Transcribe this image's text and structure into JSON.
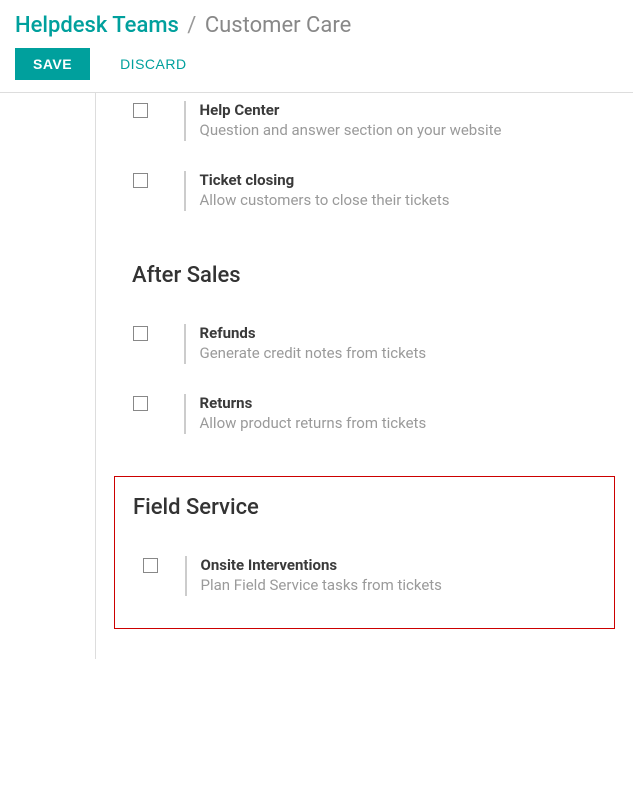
{
  "breadcrumb": {
    "parent": "Helpdesk Teams",
    "separator": "/",
    "current": "Customer Care"
  },
  "actions": {
    "save": "SAVE",
    "discard": "DISCARD"
  },
  "options": {
    "help_center": {
      "title": "Help Center",
      "desc": "Question and answer section on your website"
    },
    "ticket_closing": {
      "title": "Ticket closing",
      "desc": "Allow customers to close their tickets"
    },
    "refunds": {
      "title": "Refunds",
      "desc": "Generate credit notes from tickets"
    },
    "returns": {
      "title": "Returns",
      "desc": "Allow product returns from tickets"
    },
    "onsite": {
      "title": "Onsite Interventions",
      "desc": "Plan Field Service tasks from tickets"
    }
  },
  "sections": {
    "after_sales": "After Sales",
    "field_service": "Field Service"
  }
}
